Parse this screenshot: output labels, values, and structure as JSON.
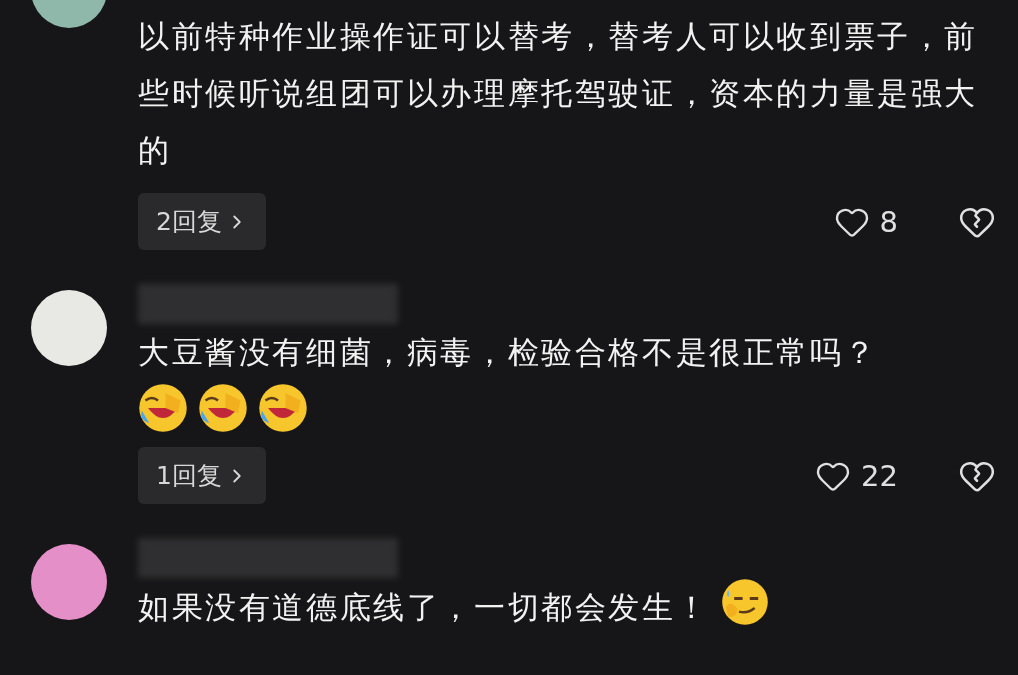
{
  "comments": [
    {
      "text": "以前特种作业操作证可以替考，替考人可以收到票子，前些时候听说组团可以办理摩托驾驶证，资本的力量是强大的",
      "replies": "2回复",
      "likes": "8"
    },
    {
      "name_hidden": true,
      "text": "大豆酱没有细菌，病毒，检验合格不是很正常吗？",
      "emojis": [
        {
          "kind": "laugh-cry"
        },
        {
          "kind": "laugh-cry"
        },
        {
          "kind": "laugh-cry"
        }
      ],
      "replies": "1回复",
      "likes": "22"
    },
    {
      "name_hidden": true,
      "text": "如果没有道德底线了，一切都会发生！",
      "emojis": [
        {
          "kind": "smirk"
        }
      ]
    }
  ]
}
